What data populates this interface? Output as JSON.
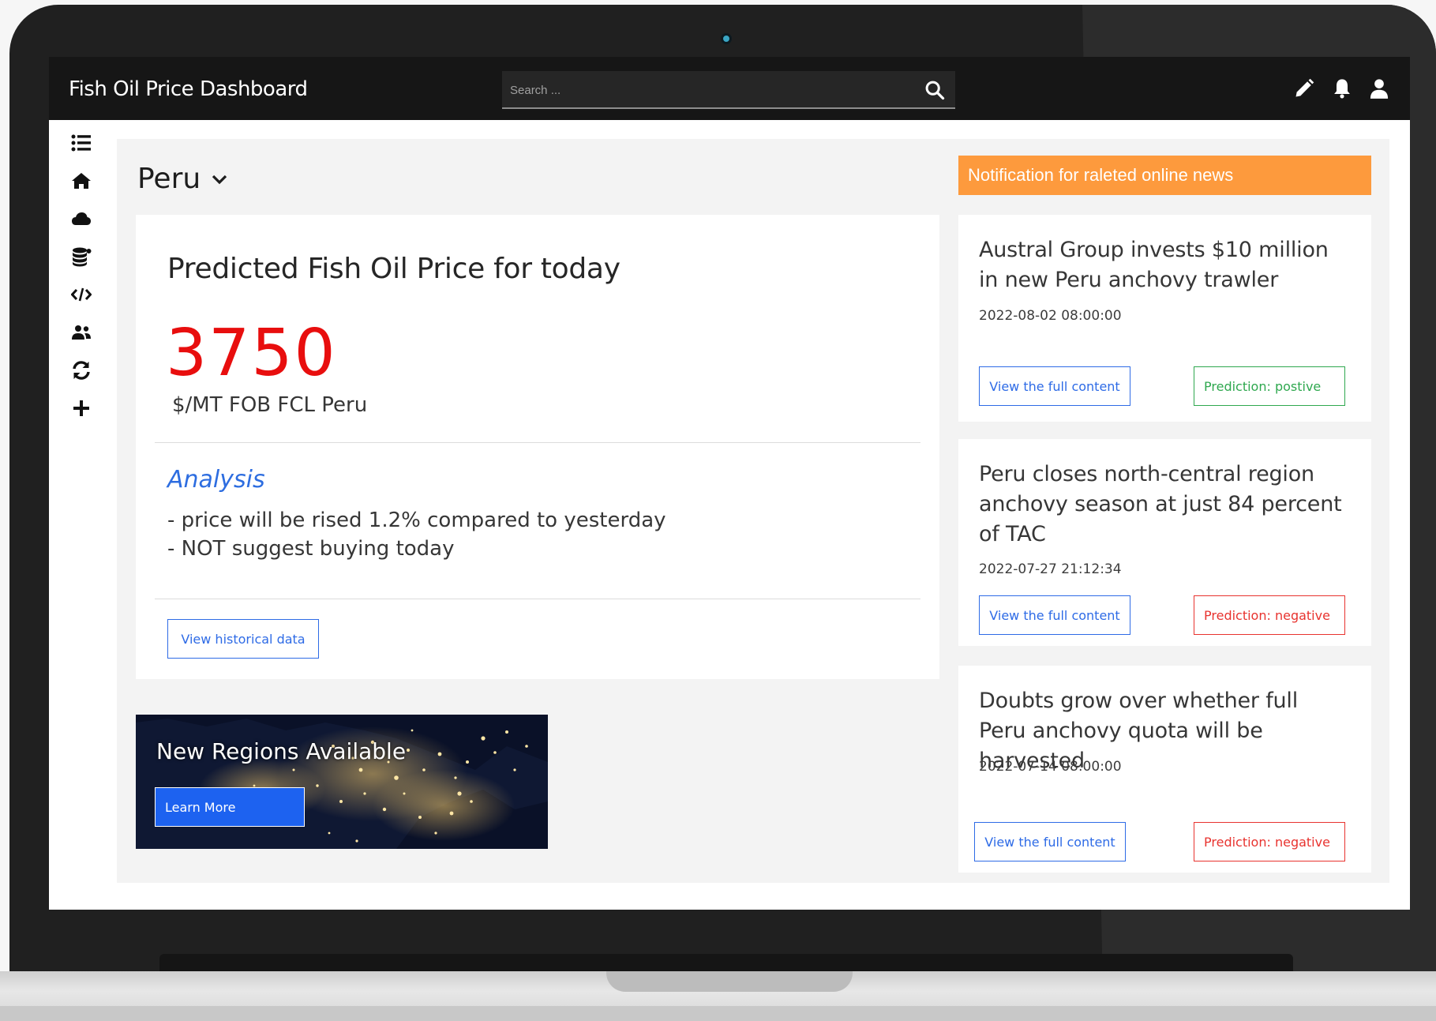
{
  "app": {
    "title": "Fish Oil Price Dashboard"
  },
  "search": {
    "placeholder": "Search ..."
  },
  "header_icons": [
    "edit-icon",
    "bell-icon",
    "user-icon"
  ],
  "sidebar": {
    "items": [
      {
        "icon": "list-icon"
      },
      {
        "icon": "home-icon"
      },
      {
        "icon": "cloud-icon"
      },
      {
        "icon": "database-icon"
      },
      {
        "icon": "code-icon"
      },
      {
        "icon": "users-icon"
      },
      {
        "icon": "refresh-icon"
      },
      {
        "icon": "plus-icon"
      }
    ]
  },
  "region": {
    "selected": "Peru"
  },
  "price_card": {
    "heading": "Predicted Fish Oil Price for today",
    "value": "3750",
    "unit": "$/MT FOB FCL Peru",
    "analysis_title": "Analysis",
    "analysis_lines": [
      "- price will be rised 1.2% compared to yesterday",
      "- NOT suggest buying today"
    ],
    "history_button": "View historical data"
  },
  "promo": {
    "title": "New Regions Available",
    "button": "Learn More"
  },
  "notifications": {
    "header": "Notification for raleted online news",
    "items": [
      {
        "title": "Austral Group invests $10 million in new Peru anchovy trawler",
        "date": "2022-08-02 08:00:00",
        "view_button": "View the full content",
        "prediction": "Prediction: postive",
        "sentiment": "positive"
      },
      {
        "title": "Peru closes north-central region anchovy season at just 84 percent of TAC",
        "date": "2022-07-27 21:12:34",
        "view_button": "View the full content",
        "prediction": "Prediction: negative",
        "sentiment": "negative"
      },
      {
        "title": "Doubts grow over whether full Peru anchovy quota will be harvested",
        "date": "2022-07-14 08:00:00",
        "view_button": "View the full content",
        "prediction": "Prediction: negative",
        "sentiment": "negative"
      }
    ]
  },
  "colors": {
    "accent_blue": "#2e6be6",
    "price_red": "#e80e0e",
    "notification_orange": "#fd9a3d",
    "positive_green": "#2fa84f",
    "negative_red": "#e8332f",
    "topbar": "#161616"
  }
}
